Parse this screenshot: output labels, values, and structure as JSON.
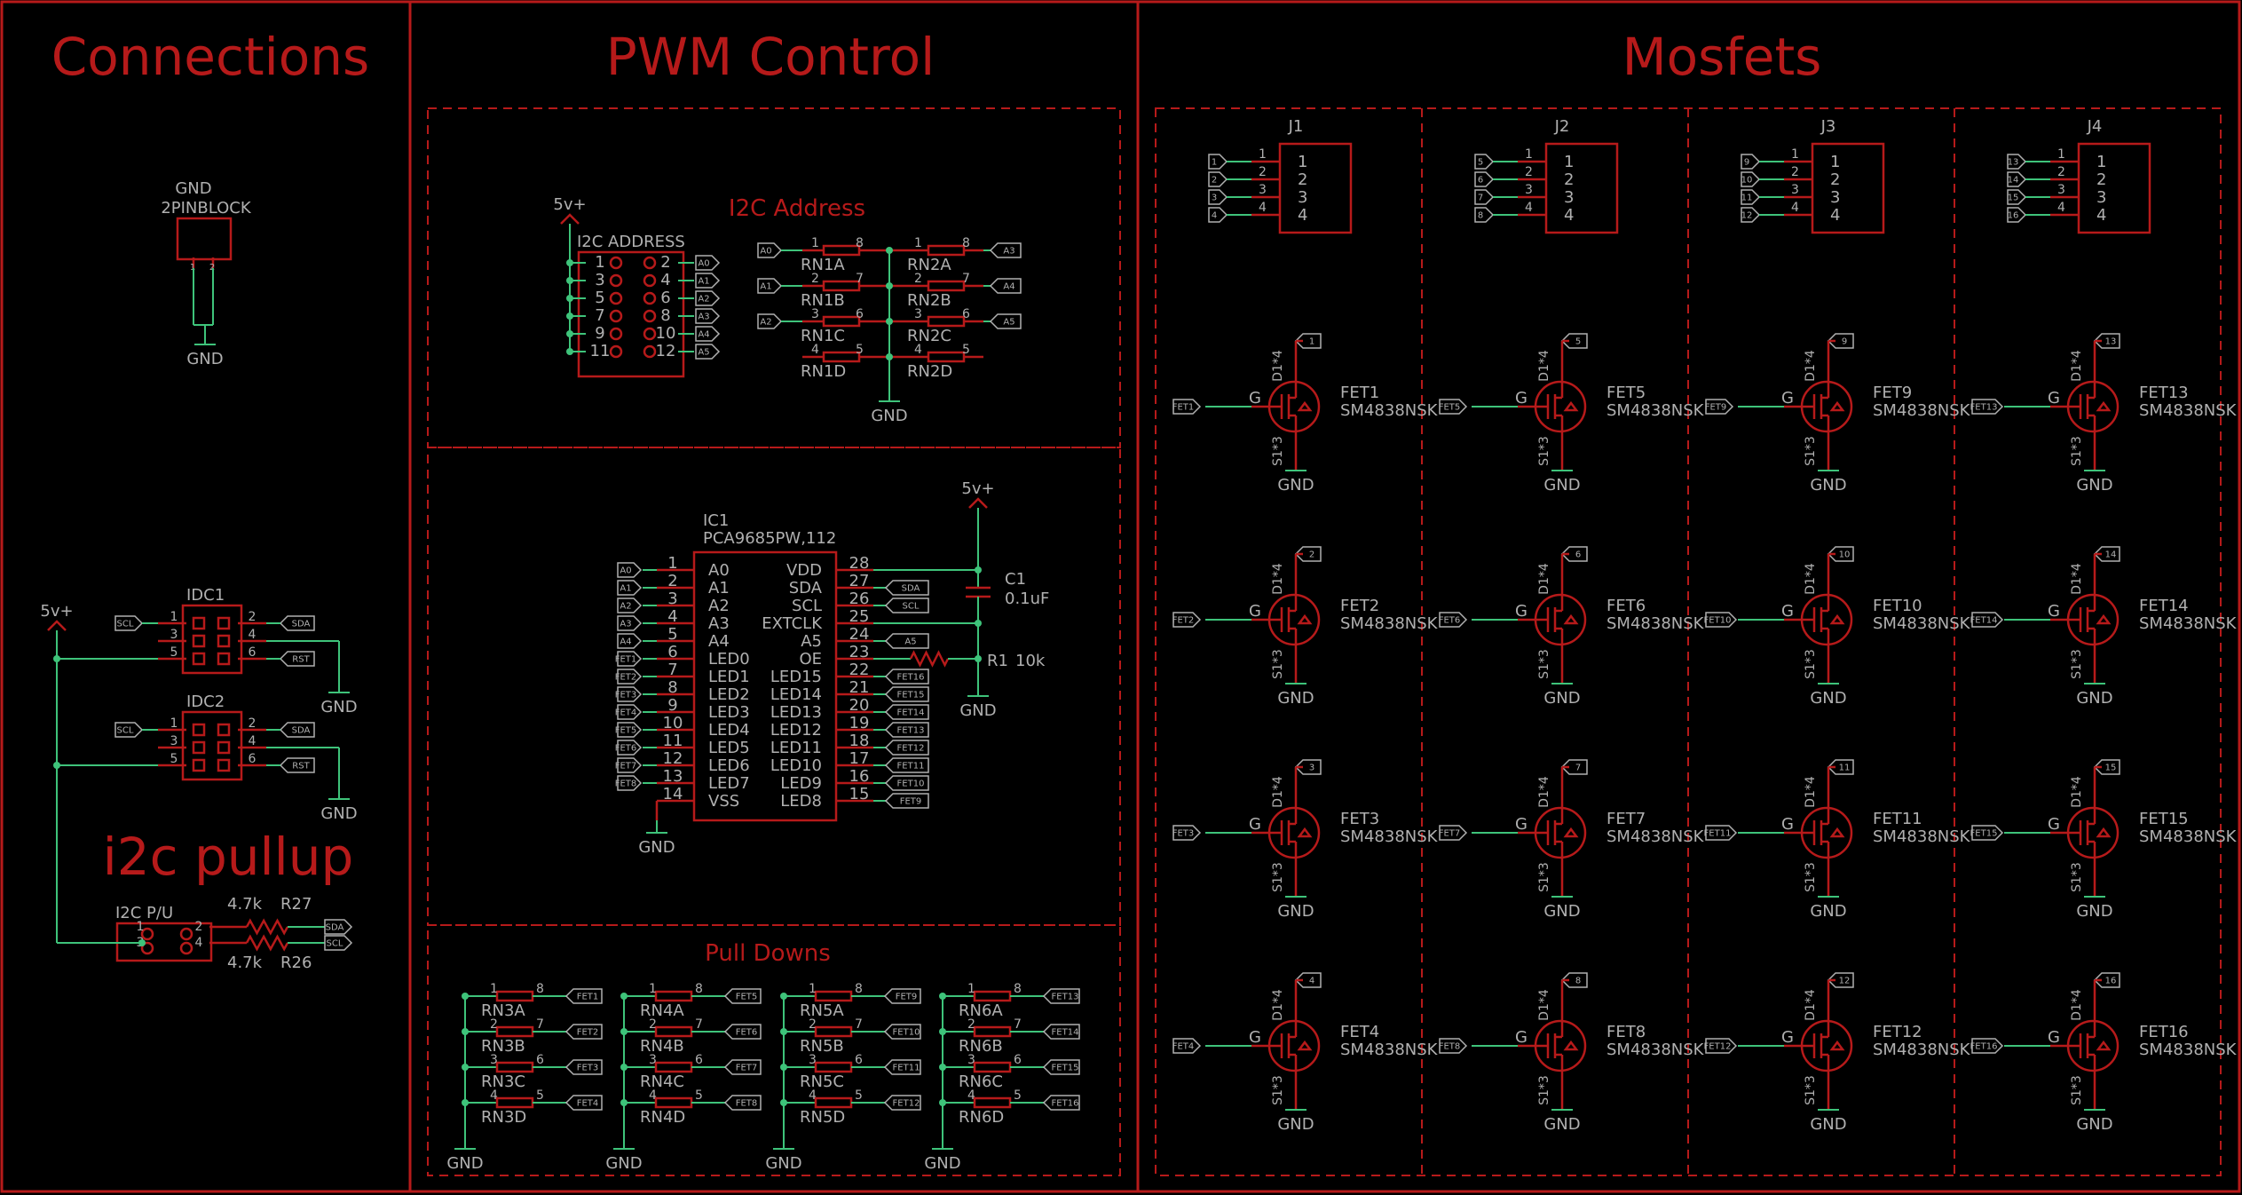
{
  "sections": {
    "connections": "Connections",
    "pwm": "PWM Control",
    "mosfets": "Mosfets",
    "i2c_address": "I2C Address",
    "pull_downs": "Pull Downs",
    "i2c_pullup": "i2c pullup"
  },
  "connections": {
    "gnd_top": "GND",
    "block_name": "2PINBLOCK",
    "pins": [
      "1",
      "2"
    ],
    "gnd": "GND",
    "supply": "5v+",
    "idc": [
      {
        "name": "IDC1",
        "left": [
          "SCL",
          "",
          ""
        ],
        "right": [
          "SDA",
          "",
          "RST"
        ],
        "pins": [
          "1",
          "2",
          "3",
          "4",
          "5",
          "6"
        ]
      },
      {
        "name": "IDC2",
        "left": [
          "SCL",
          "",
          ""
        ],
        "right": [
          "SDA",
          "",
          "RST"
        ],
        "pins": [
          "1",
          "2",
          "3",
          "4",
          "5",
          "6"
        ]
      }
    ],
    "pullup": {
      "name": "I2C P/U",
      "pins": [
        "1",
        "2",
        "3",
        "4"
      ],
      "r_top_val": "4.7k",
      "r_top_name": "R27",
      "r_bot_val": "4.7k",
      "r_bot_name": "R26",
      "nets": [
        "SDA",
        "SCL"
      ]
    }
  },
  "address": {
    "supply": "5v+",
    "header_name": "I2C ADDRESS",
    "left_pins": [
      "1",
      "3",
      "5",
      "7",
      "9",
      "11"
    ],
    "right_pins": [
      "2",
      "4",
      "6",
      "8",
      "10",
      "12"
    ],
    "nets": [
      "A0",
      "A1",
      "A2",
      "A3",
      "A4",
      "A5"
    ],
    "rn_left": [
      {
        "in": "A0",
        "name": "RN1A",
        "p1": "1",
        "p2": "8"
      },
      {
        "in": "A1",
        "name": "RN1B",
        "p1": "2",
        "p2": "7"
      },
      {
        "in": "A2",
        "name": "RN1C",
        "p1": "3",
        "p2": "6"
      },
      {
        "in": "",
        "name": "RN1D",
        "p1": "4",
        "p2": "5"
      }
    ],
    "rn_right": [
      {
        "out": "A3",
        "name": "RN2A",
        "p1": "1",
        "p2": "8"
      },
      {
        "out": "A4",
        "name": "RN2B",
        "p1": "2",
        "p2": "7"
      },
      {
        "out": "A5",
        "name": "RN2C",
        "p1": "3",
        "p2": "6"
      },
      {
        "out": "",
        "name": "RN2D",
        "p1": "4",
        "p2": "5"
      }
    ],
    "gnd": "GND"
  },
  "ic": {
    "name": "IC1",
    "part": "PCA9685PW,112",
    "left": [
      {
        "net": "A0",
        "pin": "1",
        "fn": "A0"
      },
      {
        "net": "A1",
        "pin": "2",
        "fn": "A1"
      },
      {
        "net": "A2",
        "pin": "3",
        "fn": "A2"
      },
      {
        "net": "A3",
        "pin": "4",
        "fn": "A3"
      },
      {
        "net": "A4",
        "pin": "5",
        "fn": "A4"
      },
      {
        "net": "FET1",
        "pin": "6",
        "fn": "LED0"
      },
      {
        "net": "FET2",
        "pin": "7",
        "fn": "LED1"
      },
      {
        "net": "FET3",
        "pin": "8",
        "fn": "LED2"
      },
      {
        "net": "FET4",
        "pin": "9",
        "fn": "LED3"
      },
      {
        "net": "FET5",
        "pin": "10",
        "fn": "LED4"
      },
      {
        "net": "FET6",
        "pin": "11",
        "fn": "LED5"
      },
      {
        "net": "FET7",
        "pin": "12",
        "fn": "LED6"
      },
      {
        "net": "FET8",
        "pin": "13",
        "fn": "LED7"
      },
      {
        "net": "",
        "pin": "14",
        "fn": "VSS"
      }
    ],
    "right": [
      {
        "net": "",
        "pin": "28",
        "fn": "VDD"
      },
      {
        "net": "SDA",
        "pin": "27",
        "fn": "SDA"
      },
      {
        "net": "SCL",
        "pin": "26",
        "fn": "SCL"
      },
      {
        "net": "",
        "pin": "25",
        "fn": "EXTCLK"
      },
      {
        "net": "A5",
        "pin": "24",
        "fn": "A5"
      },
      {
        "net": "",
        "pin": "23",
        "fn": "OE"
      },
      {
        "net": "FET16",
        "pin": "22",
        "fn": "LED15"
      },
      {
        "net": "FET15",
        "pin": "21",
        "fn": "LED14"
      },
      {
        "net": "FET14",
        "pin": "20",
        "fn": "LED13"
      },
      {
        "net": "FET13",
        "pin": "19",
        "fn": "LED12"
      },
      {
        "net": "FET12",
        "pin": "18",
        "fn": "LED11"
      },
      {
        "net": "FET11",
        "pin": "17",
        "fn": "LED10"
      },
      {
        "net": "FET10",
        "pin": "16",
        "fn": "LED9"
      },
      {
        "net": "FET9",
        "pin": "15",
        "fn": "LED8"
      }
    ],
    "supply": "5v+",
    "cap_name": "C1",
    "cap_val": "0.1uF",
    "res_name": "R1",
    "res_val": "10k",
    "gnd": "GND"
  },
  "pulldowns": [
    {
      "rn": [
        "RN3A",
        "RN3B",
        "RN3C",
        "RN3D"
      ],
      "nets": [
        "FET1",
        "FET2",
        "FET3",
        "FET4"
      ]
    },
    {
      "rn": [
        "RN4A",
        "RN4B",
        "RN4C",
        "RN4D"
      ],
      "nets": [
        "FET5",
        "FET6",
        "FET7",
        "FET8"
      ]
    },
    {
      "rn": [
        "RN5A",
        "RN5B",
        "RN5C",
        "RN5D"
      ],
      "nets": [
        "FET9",
        "FET10",
        "FET11",
        "FET12"
      ]
    },
    {
      "rn": [
        "RN6A",
        "RN6B",
        "RN6C",
        "RN6D"
      ],
      "nets": [
        "FET13",
        "FET14",
        "FET15",
        "FET16"
      ]
    }
  ],
  "pd_pins": [
    [
      "1",
      "8"
    ],
    [
      "2",
      "7"
    ],
    [
      "3",
      "6"
    ],
    [
      "4",
      "5"
    ]
  ],
  "pd_gnd": "GND",
  "mosfet_cols": [
    {
      "conn": "J1",
      "in": [
        "1",
        "2",
        "3",
        "4"
      ],
      "fets": [
        {
          "name": "FET1",
          "drain": "1",
          "gate": "FET1"
        },
        {
          "name": "FET2",
          "drain": "2",
          "gate": "FET2"
        },
        {
          "name": "FET3",
          "drain": "3",
          "gate": "FET3"
        },
        {
          "name": "FET4",
          "drain": "4",
          "gate": "FET4"
        }
      ]
    },
    {
      "conn": "J2",
      "in": [
        "5",
        "6",
        "7",
        "8"
      ],
      "fets": [
        {
          "name": "FET5",
          "drain": "5",
          "gate": "FET5"
        },
        {
          "name": "FET6",
          "drain": "6",
          "gate": "FET6"
        },
        {
          "name": "FET7",
          "drain": "7",
          "gate": "FET7"
        },
        {
          "name": "FET8",
          "drain": "8",
          "gate": "FET8"
        }
      ]
    },
    {
      "conn": "J3",
      "in": [
        "9",
        "10",
        "11",
        "12"
      ],
      "fets": [
        {
          "name": "FET9",
          "drain": "9",
          "gate": "FET9"
        },
        {
          "name": "FET10",
          "drain": "10",
          "gate": "FET10"
        },
        {
          "name": "FET11",
          "drain": "11",
          "gate": "FET11"
        },
        {
          "name": "FET12",
          "drain": "12",
          "gate": "FET12"
        }
      ]
    },
    {
      "conn": "J4",
      "in": [
        "13",
        "14",
        "15",
        "16"
      ],
      "fets": [
        {
          "name": "FET13",
          "drain": "13",
          "gate": "FET13"
        },
        {
          "name": "FET14",
          "drain": "14",
          "gate": "FET14"
        },
        {
          "name": "FET15",
          "drain": "15",
          "gate": "FET15"
        },
        {
          "name": "FET16",
          "drain": "16",
          "gate": "FET16"
        }
      ]
    }
  ],
  "conn_pins": [
    "1",
    "2",
    "3",
    "4"
  ],
  "fet_part": "SM4838NSK",
  "fet_g": "G",
  "fet_d": "D1*4",
  "fet_s": "S1*3",
  "fet_gnd": "GND",
  "colors": {
    "frame": "#b61a1a",
    "wire": "#3ec37a",
    "text": "#b0b0b0",
    "background": "#000000"
  }
}
